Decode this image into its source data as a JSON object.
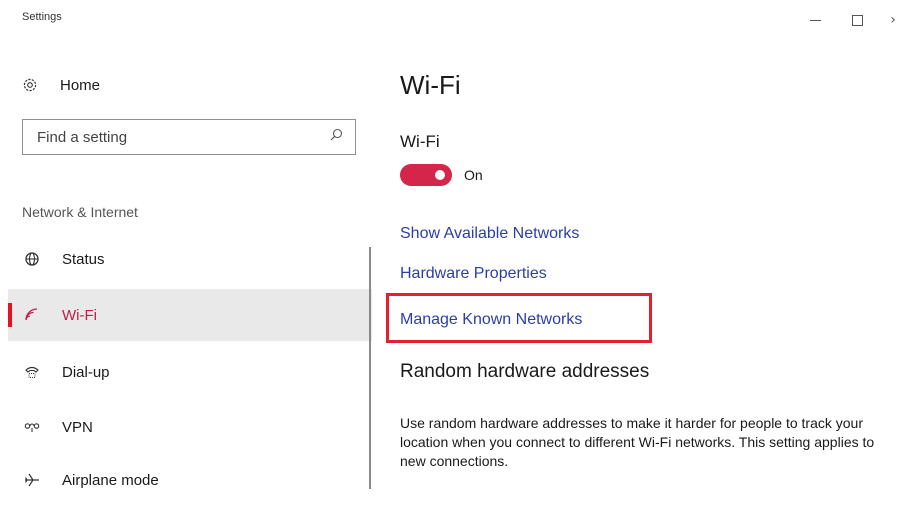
{
  "window": {
    "title": "Settings",
    "minimize_glyph": "",
    "close_glyph": "›"
  },
  "sidebar": {
    "home": {
      "label": "Home",
      "icon": "gear-icon"
    },
    "search": {
      "placeholder": "Find a setting",
      "value": "",
      "icon": "search-icon"
    },
    "section_label": "Network & Internet",
    "items": [
      {
        "label": "Status",
        "icon": "globe-icon",
        "selected": false
      },
      {
        "label": "Wi-Fi",
        "icon": "wifi-icon",
        "selected": true
      },
      {
        "label": "Dial-up",
        "icon": "phone-icon",
        "selected": false
      },
      {
        "label": "VPN",
        "icon": "vpn-icon",
        "selected": false
      },
      {
        "label": "Airplane mode",
        "icon": "airplane-icon",
        "selected": false
      }
    ]
  },
  "main": {
    "title": "Wi-Fi",
    "wifi_toggle": {
      "label": "Wi-Fi",
      "state": "On",
      "on": true
    },
    "links": {
      "show_networks": "Show Available Networks",
      "hardware_properties": "Hardware Properties",
      "manage_known": "Manage Known Networks"
    },
    "random_hw": {
      "heading": "Random hardware addresses",
      "description": "Use random hardware addresses to make it harder for people to track your location when you connect to different Wi-Fi networks. This setting applies to new connections."
    }
  },
  "colors": {
    "accent": "#d4264a",
    "link": "#2b3ea8",
    "selected_bg": "#e9e9e9",
    "highlight": "#e3202f"
  }
}
